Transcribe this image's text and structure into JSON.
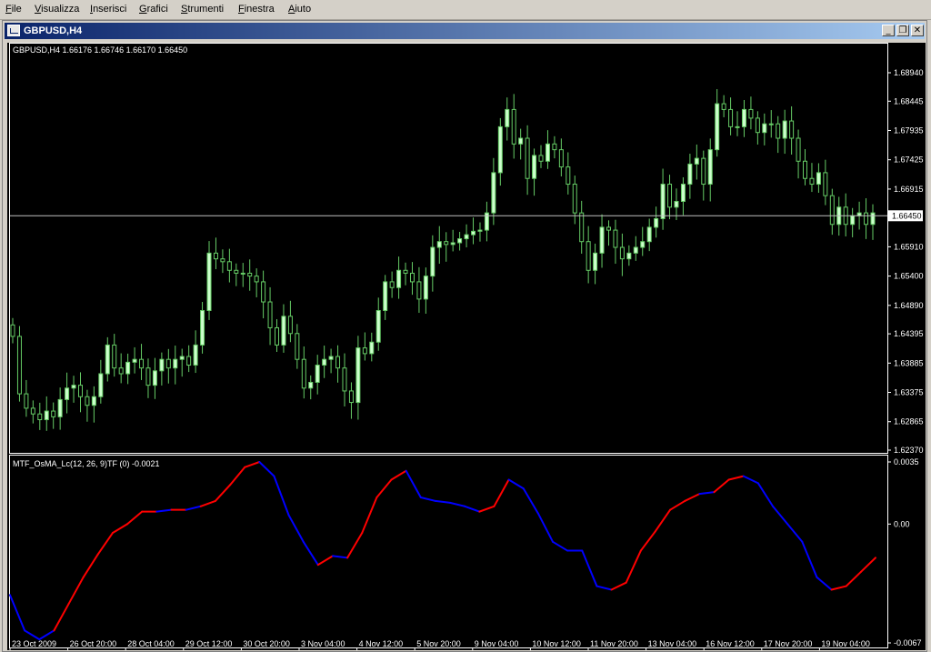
{
  "menu": [
    "File",
    "Visualizza",
    "Inserisci",
    "Grafici",
    "Strumenti",
    "Finestra",
    "Aiuto"
  ],
  "window": {
    "title": "GBPUSD,H4",
    "icon": "chart-window-icon",
    "buttons": [
      "minimize",
      "restore",
      "close"
    ]
  },
  "main_chart": {
    "label": "GBPUSD,H4  1.66176 1.66746 1.66170 1.66450",
    "price_labels": [
      "1.68940",
      "1.68445",
      "1.67935",
      "1.67425",
      "1.66915",
      "1.66450",
      "1.65910",
      "1.65400",
      "1.64890",
      "1.64395",
      "1.63885",
      "1.63375",
      "1.62865",
      "1.62370"
    ],
    "current_price": "1.66450"
  },
  "indicator": {
    "label": "MTF_OsMA_Lc(12, 26, 9)TF (0) -0.0021",
    "scale_labels": [
      "0.0035",
      "0.00",
      "-0.0067"
    ]
  },
  "time_labels": [
    "23 Oct 2009",
    "26 Oct 20:00",
    "28 Oct 04:00",
    "29 Oct 12:00",
    "30 Oct 20:00",
    "3 Nov 04:00",
    "4 Nov 12:00",
    "5 Nov 20:00",
    "9 Nov 04:00",
    "10 Nov 12:00",
    "11 Nov 20:00",
    "13 Nov 04:00",
    "16 Nov 12:00",
    "17 Nov 20:00",
    "19 Nov 04:00"
  ],
  "colors": {
    "background": "#000000",
    "bull_candle": "#ccffcc",
    "candle_line": "#66cc66",
    "osma_up": "#ff0000",
    "osma_down": "#0000ff",
    "frame": "#ffffff",
    "price_line": "#c0c0c0"
  },
  "chart_data": [
    {
      "type": "candlestick",
      "title": "GBPUSD,H4",
      "ylim": [
        1.6237,
        1.6894
      ],
      "close": [
        1.6435,
        1.6335,
        1.631,
        1.63,
        1.629,
        1.6305,
        1.6295,
        1.6325,
        1.6345,
        1.635,
        1.633,
        1.6315,
        1.633,
        1.637,
        1.642,
        1.638,
        1.637,
        1.639,
        1.6395,
        1.638,
        1.635,
        1.6375,
        1.6395,
        1.638,
        1.6395,
        1.64,
        1.6385,
        1.642,
        1.648,
        1.658,
        1.657,
        1.6565,
        1.655,
        1.6545,
        1.6545,
        1.654,
        1.653,
        1.6495,
        1.645,
        1.642,
        1.647,
        1.644,
        1.6395,
        1.6345,
        1.6355,
        1.6385,
        1.6395,
        1.64,
        1.638,
        1.634,
        1.632,
        1.6415,
        1.6405,
        1.6425,
        1.648,
        1.653,
        1.652,
        1.655,
        1.6545,
        1.653,
        1.65,
        1.654,
        1.659,
        1.66,
        1.6595,
        1.6598,
        1.6605,
        1.6612,
        1.6618,
        1.662,
        1.665,
        1.672,
        1.68,
        1.683,
        1.677,
        1.678,
        1.671,
        1.675,
        1.674,
        1.677,
        1.676,
        1.673,
        1.67,
        1.665,
        1.66,
        1.655,
        1.658,
        1.6625,
        1.662,
        1.659,
        1.657,
        1.658,
        1.659,
        1.66,
        1.6625,
        1.664,
        1.67,
        1.666,
        1.667,
        1.67,
        1.6735,
        1.6745,
        1.67,
        1.676,
        1.684,
        1.683,
        1.68,
        1.68,
        1.683,
        1.6815,
        1.679,
        1.6805,
        1.6805,
        1.678,
        1.681,
        1.678,
        1.674,
        1.671,
        1.67,
        1.672,
        1.668,
        1.663,
        1.666,
        1.663,
        1.6645,
        1.665,
        1.663,
        1.665
      ]
    },
    {
      "type": "line",
      "title": "MTF_OsMA_Lc(12, 26, 9)TF (0) -0.0021",
      "ylim": [
        -0.0067,
        0.0035
      ],
      "x_labels": [
        "23 Oct 2009",
        "26 Oct 20:00",
        "28 Oct 04:00",
        "29 Oct 12:00",
        "30 Oct 20:00",
        "3 Nov 04:00",
        "4 Nov 12:00",
        "5 Nov 20:00",
        "9 Nov 04:00",
        "10 Nov 12:00",
        "11 Nov 20:00",
        "13 Nov 04:00",
        "16 Nov 12:00",
        "17 Nov 20:00",
        "19 Nov 04:00"
      ],
      "values": [
        -0.004,
        -0.006,
        -0.0065,
        -0.006,
        -0.0045,
        -0.003,
        -0.0017,
        -0.0005,
        0.0,
        0.0007,
        0.0007,
        0.0008,
        0.0008,
        0.001,
        0.0013,
        0.0022,
        0.0032,
        0.0035,
        0.0027,
        0.0005,
        -0.001,
        -0.0023,
        -0.0018,
        -0.0019,
        -0.0005,
        0.0015,
        0.0025,
        0.003,
        0.0015,
        0.0013,
        0.0012,
        0.001,
        0.0007,
        0.001,
        0.0025,
        0.002,
        0.0006,
        -0.001,
        -0.0015,
        -0.0015,
        -0.0035,
        -0.0037,
        -0.0033,
        -0.0015,
        -0.0004,
        0.0008,
        0.0013,
        0.0017,
        0.0018,
        0.0025,
        0.0027,
        0.0023,
        0.001,
        0.0,
        -0.001,
        -0.003,
        -0.0037,
        -0.0035,
        -0.0027,
        -0.0019
      ],
      "up_flags": [
        0,
        0,
        0,
        1,
        1,
        1,
        1,
        1,
        1,
        1,
        0,
        1,
        0,
        1,
        1,
        1,
        1,
        0,
        0,
        0,
        0,
        1,
        0,
        1,
        1,
        1,
        1,
        0,
        0,
        0,
        0,
        0,
        1,
        1,
        0,
        0,
        0,
        0,
        0,
        0,
        0,
        1,
        1,
        1,
        1,
        1,
        1,
        0,
        1,
        1,
        0,
        0,
        0,
        0,
        0,
        0,
        1,
        1,
        1,
        1
      ]
    }
  ]
}
